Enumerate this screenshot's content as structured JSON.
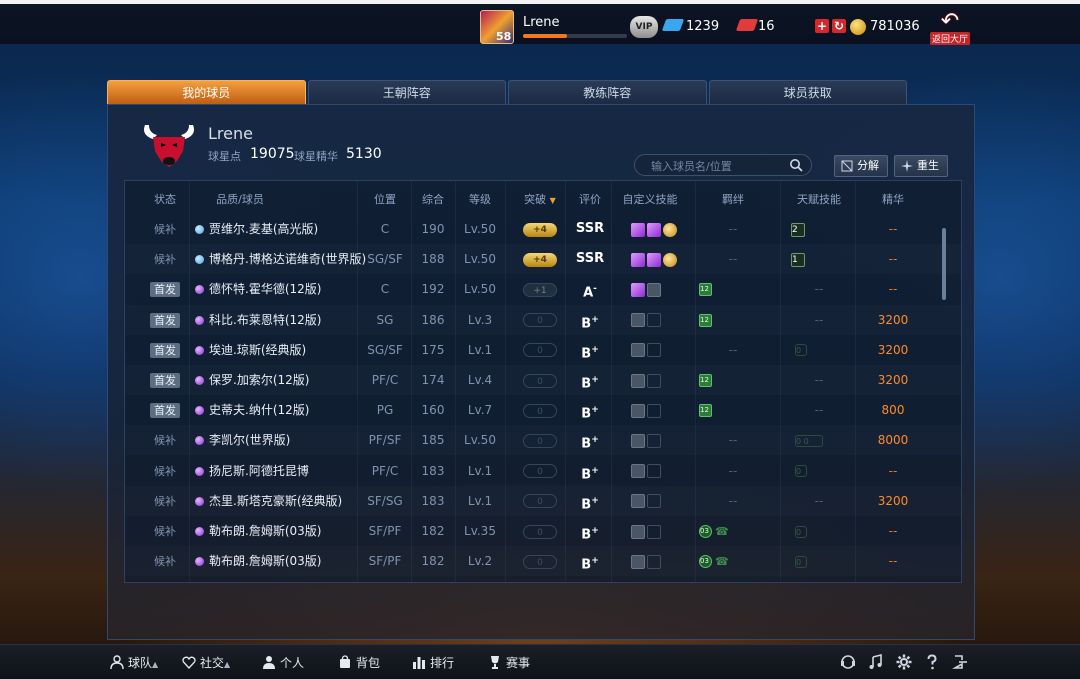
{
  "header": {
    "player_name": "Lrene",
    "level": "58",
    "xp_progress": 0.42,
    "vip_label": "VIP",
    "diamonds": "1239",
    "tickets": "16",
    "coins": "781036",
    "back_label": "返回大厅"
  },
  "tabs": [
    {
      "label": "我的球员",
      "active": true
    },
    {
      "label": "王朝阵容",
      "active": false
    },
    {
      "label": "教练阵容",
      "active": false
    },
    {
      "label": "球员获取",
      "active": false
    }
  ],
  "team": {
    "name": "Lrene",
    "star_points_label": "球星点",
    "star_points": "19075",
    "essence_label": "球星精华",
    "essence": "5130"
  },
  "search": {
    "placeholder": "输入球员名/位置"
  },
  "buttons": {
    "decompose": "分解",
    "rebirth": "重生"
  },
  "columns": {
    "status": "状态",
    "player": "品质/球员",
    "position": "位置",
    "overall": "综合",
    "level": "等级",
    "breakthrough": "突破",
    "rating": "评价",
    "custom_skills": "自定义技能",
    "bonds": "羁绊",
    "talent": "天赋技能",
    "essence": "精华"
  },
  "players": [
    {
      "status": "候补",
      "starter": false,
      "quality": "blue",
      "name": "贾维尔.麦基(高光版)",
      "pos": "C",
      "ovr": "190",
      "lvl": "Lv.50",
      "brk": "+4",
      "brk_style": "gold",
      "rating": "SSR",
      "rating_sup": "",
      "skills": [
        "purple",
        "purple",
        "gold"
      ],
      "bond": "--",
      "bond_icons": 0,
      "talent": "2",
      "talent_style": "box",
      "ess": "--"
    },
    {
      "status": "候补",
      "starter": false,
      "quality": "blue",
      "name": "博格丹.博格达诺维奇(世界版)",
      "pos": "SG/SF",
      "ovr": "188",
      "lvl": "Lv.50",
      "brk": "+4",
      "brk_style": "gold",
      "rating": "SSR",
      "rating_sup": "",
      "skills": [
        "purple",
        "purple",
        "gold"
      ],
      "bond": "--",
      "bond_icons": 0,
      "talent": "1",
      "talent_style": "box",
      "ess": "--"
    },
    {
      "status": "首发",
      "starter": true,
      "quality": "purple",
      "name": "德怀特.霍华德(12版)",
      "pos": "C",
      "ovr": "192",
      "lvl": "Lv.50",
      "brk": "+1",
      "brk_style": "dark",
      "rating": "A",
      "rating_sup": "-",
      "skills": [
        "purple",
        "lock"
      ],
      "bond": "12",
      "bond_icons": 1,
      "talent": "--",
      "talent_style": "dash",
      "ess": "--"
    },
    {
      "status": "首发",
      "starter": true,
      "quality": "purple",
      "name": "科比.布莱恩特(12版)",
      "pos": "SG",
      "ovr": "186",
      "lvl": "Lv.3",
      "brk": "0",
      "brk_style": "empty",
      "rating": "B",
      "rating_sup": "+",
      "skills": [
        "lock",
        "empty"
      ],
      "bond": "12",
      "bond_icons": 1,
      "talent": "--",
      "talent_style": "dash",
      "ess": "3200"
    },
    {
      "status": "首发",
      "starter": true,
      "quality": "purple",
      "name": "埃迪.琼斯(经典版)",
      "pos": "SG/SF",
      "ovr": "175",
      "lvl": "Lv.1",
      "brk": "0",
      "brk_style": "empty",
      "rating": "B",
      "rating_sup": "+",
      "skills": [
        "lock",
        "empty"
      ],
      "bond": "--",
      "bond_icons": 0,
      "talent": "0",
      "talent_style": "empty",
      "ess": "3200"
    },
    {
      "status": "首发",
      "starter": true,
      "quality": "purple",
      "name": "保罗.加索尔(12版)",
      "pos": "PF/C",
      "ovr": "174",
      "lvl": "Lv.4",
      "brk": "0",
      "brk_style": "empty",
      "rating": "B",
      "rating_sup": "+",
      "skills": [
        "lock",
        "empty"
      ],
      "bond": "12",
      "bond_icons": 1,
      "talent": "--",
      "talent_style": "dash",
      "ess": "3200"
    },
    {
      "status": "首发",
      "starter": true,
      "quality": "purple",
      "name": "史蒂夫.纳什(12版)",
      "pos": "PG",
      "ovr": "160",
      "lvl": "Lv.7",
      "brk": "0",
      "brk_style": "empty",
      "rating": "B",
      "rating_sup": "+",
      "skills": [
        "lock",
        "empty"
      ],
      "bond": "12",
      "bond_icons": 1,
      "talent": "--",
      "talent_style": "dash",
      "ess": "800"
    },
    {
      "status": "候补",
      "starter": false,
      "quality": "purple",
      "name": "李凯尔(世界版)",
      "pos": "PF/SF",
      "ovr": "185",
      "lvl": "Lv.50",
      "brk": "0",
      "brk_style": "empty",
      "rating": "B",
      "rating_sup": "+",
      "skills": [
        "lock",
        "empty"
      ],
      "bond": "--",
      "bond_icons": 0,
      "talent": "0 0",
      "talent_style": "empty2",
      "ess": "8000"
    },
    {
      "status": "候补",
      "starter": false,
      "quality": "purple",
      "name": "扬尼斯.阿德托昆博",
      "pos": "PF/C",
      "ovr": "183",
      "lvl": "Lv.1",
      "brk": "0",
      "brk_style": "empty",
      "rating": "B",
      "rating_sup": "+",
      "skills": [
        "lock",
        "empty"
      ],
      "bond": "--",
      "bond_icons": 0,
      "talent": "0",
      "talent_style": "empty",
      "ess": "--"
    },
    {
      "status": "候补",
      "starter": false,
      "quality": "purple",
      "name": "杰里.斯塔克豪斯(经典版)",
      "pos": "SF/SG",
      "ovr": "183",
      "lvl": "Lv.1",
      "brk": "0",
      "brk_style": "empty",
      "rating": "B",
      "rating_sup": "+",
      "skills": [
        "lock",
        "empty"
      ],
      "bond": "--",
      "bond_icons": 0,
      "talent": "--",
      "talent_style": "dash",
      "ess": "3200"
    },
    {
      "status": "候补",
      "starter": false,
      "quality": "purple",
      "name": "勒布朗.詹姆斯(03版)",
      "pos": "SF/PF",
      "ovr": "182",
      "lvl": "Lv.35",
      "brk": "0",
      "brk_style": "empty",
      "rating": "B",
      "rating_sup": "+",
      "skills": [
        "lock",
        "empty"
      ],
      "bond": "03",
      "bond_icons": 2,
      "talent": "0",
      "talent_style": "empty",
      "ess": "--"
    },
    {
      "status": "候补",
      "starter": false,
      "quality": "purple",
      "name": "勒布朗.詹姆斯(03版)",
      "pos": "SF/PF",
      "ovr": "182",
      "lvl": "Lv.2",
      "brk": "0",
      "brk_style": "empty",
      "rating": "B",
      "rating_sup": "+",
      "skills": [
        "lock",
        "empty"
      ],
      "bond": "03",
      "bond_icons": 2,
      "talent": "0",
      "talent_style": "empty",
      "ess": "--"
    }
  ],
  "bottom_nav": [
    {
      "label": "球队",
      "icon": "person-icon",
      "caret": true
    },
    {
      "label": "社交",
      "icon": "heart-icon",
      "caret": true
    },
    {
      "label": "个人",
      "icon": "user-icon",
      "caret": false
    },
    {
      "label": "背包",
      "icon": "bag-icon",
      "caret": false
    },
    {
      "label": "排行",
      "icon": "ranking-icon",
      "caret": false
    },
    {
      "label": "赛事",
      "icon": "trophy-icon",
      "caret": false
    }
  ],
  "bottom_tools": [
    "support-icon",
    "music-icon",
    "gear-icon",
    "help-icon",
    "exit-icon"
  ],
  "colors": {
    "accent_orange": "#f07a1a",
    "essence_orange": "#ff8a2a",
    "tab_active": "#d9701c"
  }
}
